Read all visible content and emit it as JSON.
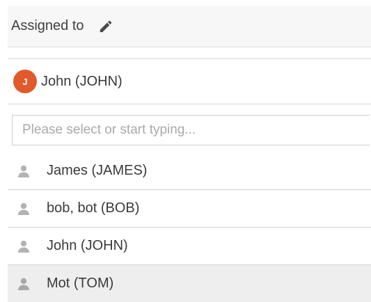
{
  "header": {
    "title": "Assigned to",
    "edit_icon": "pencil-icon"
  },
  "assignee": {
    "avatar_letter": "J",
    "avatar_color": "#e25a2b",
    "name": "John (JOHN)"
  },
  "search": {
    "placeholder": "Please select or start typing...",
    "value": ""
  },
  "options": [
    {
      "label": "James (JAMES)",
      "icon": "user-icon"
    },
    {
      "label": "bob, bot (BOB)",
      "icon": "user-icon"
    },
    {
      "label": "John (JOHN)",
      "icon": "user-icon"
    },
    {
      "label": "Mot (TOM)",
      "icon": "user-icon",
      "highlighted": true
    }
  ]
}
